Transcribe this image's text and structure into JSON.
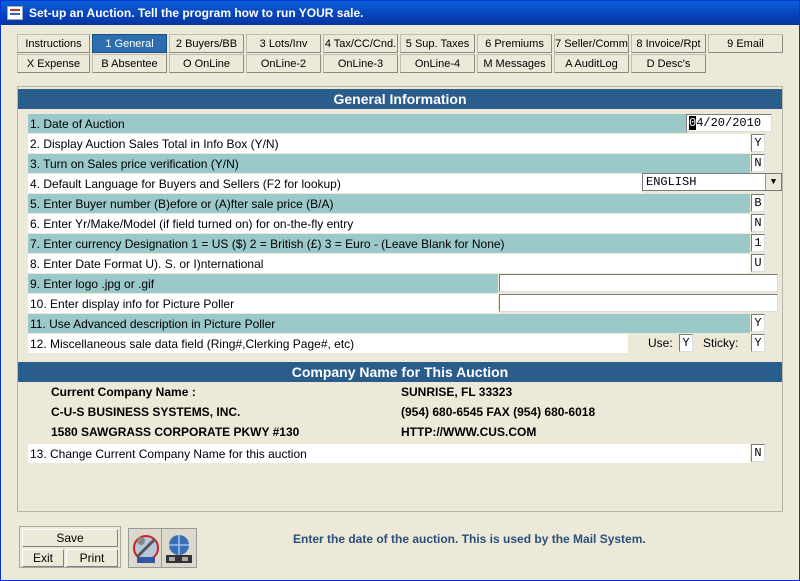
{
  "window": {
    "title": "Set-up an Auction.   Tell the program how to run YOUR sale."
  },
  "tabs_row1": [
    {
      "label": "Instructions"
    },
    {
      "label": "1 General"
    },
    {
      "label": "2 Buyers/BB"
    },
    {
      "label": "3 Lots/Inv"
    },
    {
      "label": "4 Tax/CC/Cnd."
    },
    {
      "label": "5 Sup. Taxes"
    },
    {
      "label": "6 Premiums"
    },
    {
      "label": "7 Seller/Comm"
    },
    {
      "label": "8 Invoice/Rpt"
    },
    {
      "label": "9 Email"
    }
  ],
  "tabs_row2": [
    {
      "label": "X Expense"
    },
    {
      "label": "B Absentee"
    },
    {
      "label": "O OnLine"
    },
    {
      "label": "OnLine-2"
    },
    {
      "label": "OnLine-3"
    },
    {
      "label": "OnLine-4"
    },
    {
      "label": "M Messages"
    },
    {
      "label": "A AuditLog"
    },
    {
      "label": "D Desc's"
    }
  ],
  "general": {
    "header": "General Information",
    "rows": [
      {
        "label": "1. Date of Auction",
        "value": "04/20/2010"
      },
      {
        "label": "2. Display Auction Sales Total in Info Box (Y/N)",
        "value": "Y"
      },
      {
        "label": "3. Turn on Sales price verification (Y/N)",
        "value": "N"
      },
      {
        "label": "4. Default Language for Buyers and Sellers (F2 for lookup)",
        "value": "ENGLISH"
      },
      {
        "label": "5. Enter Buyer number  (B)efore or (A)fter sale price (B/A)",
        "value": "B"
      },
      {
        "label": "6. Enter Yr/Make/Model (if field turned on) for on-the-fly entry",
        "value": "N"
      },
      {
        "label": "7. Enter currency Designation 1 = US ($) 2 = British (£) 3 = Euro - (Leave Blank for None)",
        "value": "1"
      },
      {
        "label": "8. Enter Date Format U). S. or I)nternational",
        "value": "U"
      },
      {
        "label": "9. Enter logo .jpg or .gif",
        "value": ""
      },
      {
        "label": "10. Enter display info for Picture Poller",
        "value": ""
      },
      {
        "label": "11. Use Advanced description in Picture Poller",
        "value": "Y"
      },
      {
        "label": "12. Miscellaneous sale data field (Ring#,Clerking Page#, etc)",
        "use_label": "Use:",
        "use_value": "Y",
        "sticky_label": "Sticky:",
        "sticky_value": "Y"
      }
    ]
  },
  "company": {
    "header": "Company Name for This Auction",
    "current_label": "Current Company Name :",
    "name": "C-U-S BUSINESS SYSTEMS, INC.",
    "address": "1580 SAWGRASS CORPORATE PKWY #130",
    "city": "SUNRISE, FL 33323",
    "phone": "(954) 680-6545    FAX (954) 680-6018",
    "web": "HTTP://WWW.CUS.COM",
    "change_label": "13. Change Current Company Name for this auction",
    "change_value": "N"
  },
  "buttons": {
    "save": "Save",
    "exit": "Exit",
    "print": "Print"
  },
  "status": "Enter the date of the auction.  This is used by the Mail System.",
  "colors": {
    "accent": "#2b5d8c",
    "row_teal": "#9bc8c8",
    "titlebar": "#0842b8"
  }
}
